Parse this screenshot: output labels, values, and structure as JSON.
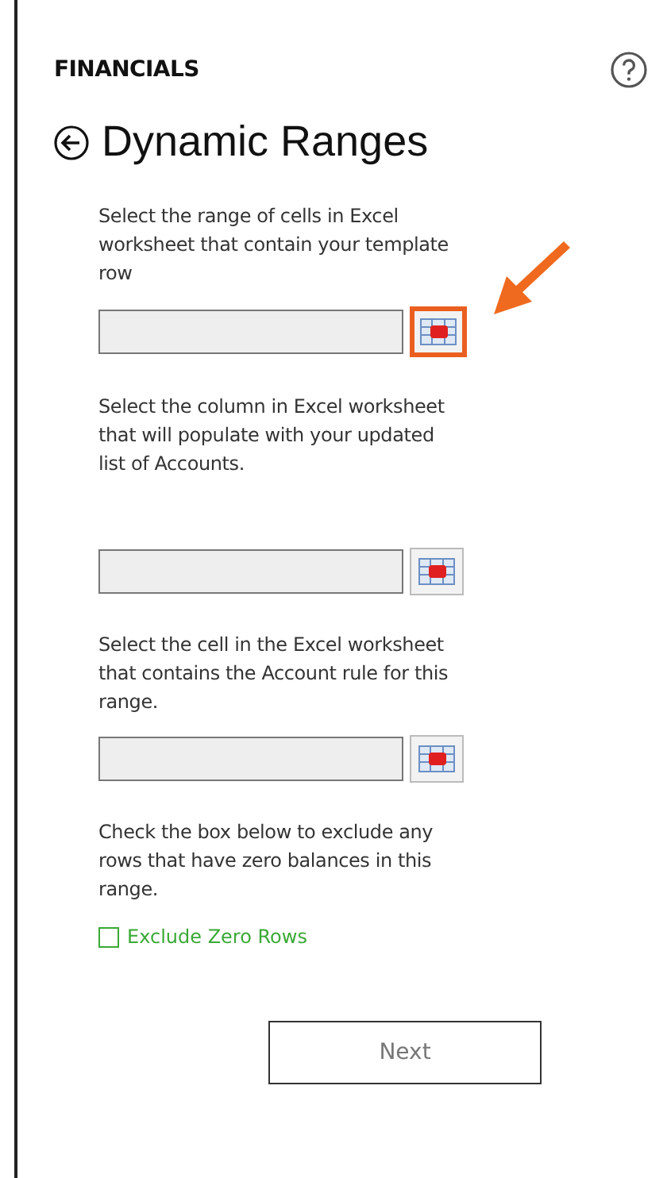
{
  "header": {
    "section": "FINANCIALS",
    "title": "Dynamic Ranges"
  },
  "steps": [
    {
      "instruction": "Select the range of cells in Excel worksheet that contain your template row",
      "highlighted": true
    },
    {
      "instruction": "Select the column in Excel worksheet that will populate with your updated list of Accounts.",
      "highlighted": false
    },
    {
      "instruction": "Select the cell in the Excel worksheet that contains the Account rule for this range.",
      "highlighted": false
    }
  ],
  "exclude": {
    "instruction": "Check the box below to exclude any rows that have zero balances in this range.",
    "label": "Exclude Zero Rows",
    "checked": false
  },
  "buttons": [
    "Next"
  ]
}
